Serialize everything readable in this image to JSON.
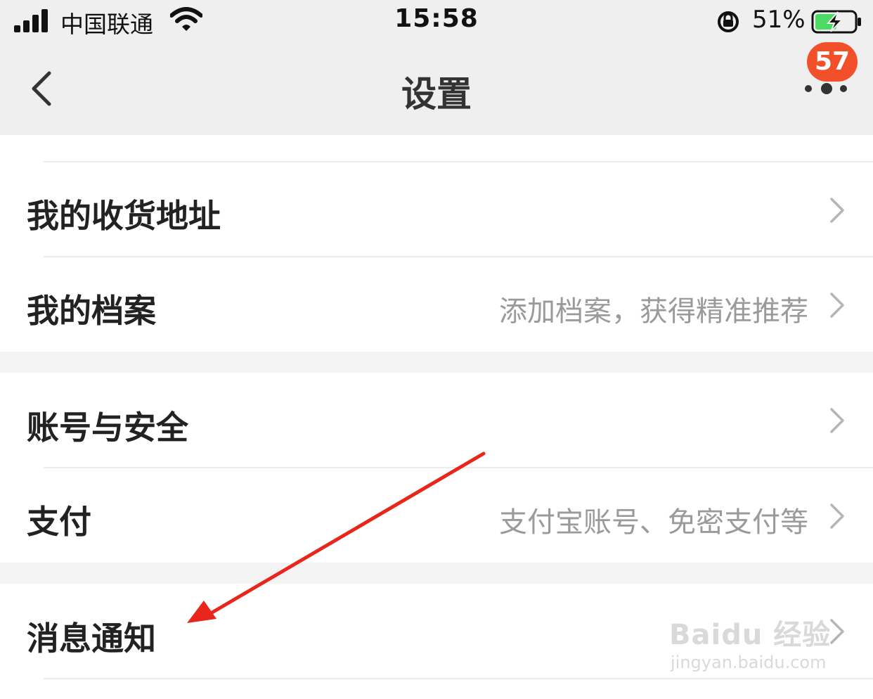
{
  "status_bar": {
    "carrier": "中国联通",
    "time": "15:58",
    "battery_percent": "51%"
  },
  "nav": {
    "title": "设置",
    "badge_count": "57"
  },
  "settings_rows": [
    {
      "label": "我的收货地址",
      "hint": ""
    },
    {
      "label": "我的档案",
      "hint": "添加档案，获得精准推荐"
    },
    {
      "label": "账号与安全",
      "hint": ""
    },
    {
      "label": "支付",
      "hint": "支付宝账号、免密支付等"
    },
    {
      "label": "消息通知",
      "hint": ""
    }
  ],
  "watermark": {
    "logo_text": "Baidu 经验",
    "url": "jingyan.baidu.com"
  },
  "colors": {
    "badge": "#f2502b",
    "annotation_arrow": "#e8261c",
    "header_bg": "#efefef",
    "section_gap": "#f3f3f3"
  },
  "icons": [
    "signal-icon",
    "wifi-icon",
    "rotation-lock-icon",
    "battery-charging-icon",
    "back-arrow-icon",
    "more-dots-icon",
    "chevron-right-icon"
  ]
}
